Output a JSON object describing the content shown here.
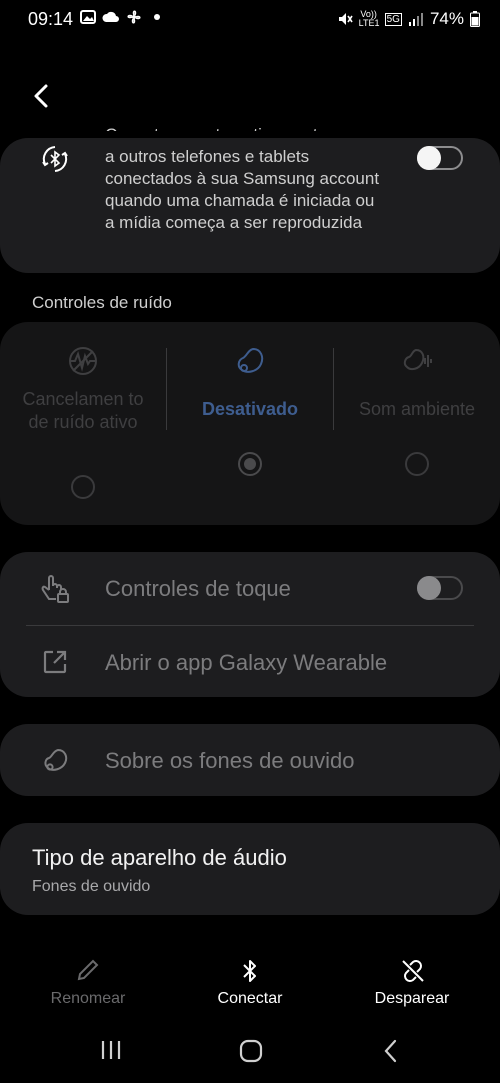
{
  "status_bar": {
    "time": "09:14",
    "volte": "Vo)) LTE1",
    "network": "5G",
    "battery": "74%"
  },
  "auto_switch": {
    "description_partial": "Conecta-se automaticamente",
    "description": "a outros telefones e tablets conectados à sua Samsung account quando uma chamada é iniciada ou a mídia começa a ser reproduzida",
    "toggle_on": false
  },
  "noise": {
    "section_title": "Controles de ruído",
    "options": [
      {
        "label": "Cancelamen to de ruído ativo",
        "icon": "anc-icon",
        "selected": false
      },
      {
        "label": "Desativado",
        "icon": "earbud-icon",
        "selected": true
      },
      {
        "label": "Som ambiente",
        "icon": "ambient-icon",
        "selected": false
      }
    ]
  },
  "touch": {
    "label": "Controles de toque",
    "toggle_on": false,
    "wearable_label": "Abrir o app Galaxy Wearable"
  },
  "about": {
    "label": "Sobre os fones de ouvido"
  },
  "device_type": {
    "title": "Tipo de aparelho de áudio",
    "value": "Fones de ouvido"
  },
  "bottom_actions": {
    "rename": "Renomear",
    "connect": "Conectar",
    "unpair": "Desparear"
  },
  "colors": {
    "accent_selected": "#4a6fa8",
    "background": "#000000",
    "card": "#1d1d1f"
  }
}
